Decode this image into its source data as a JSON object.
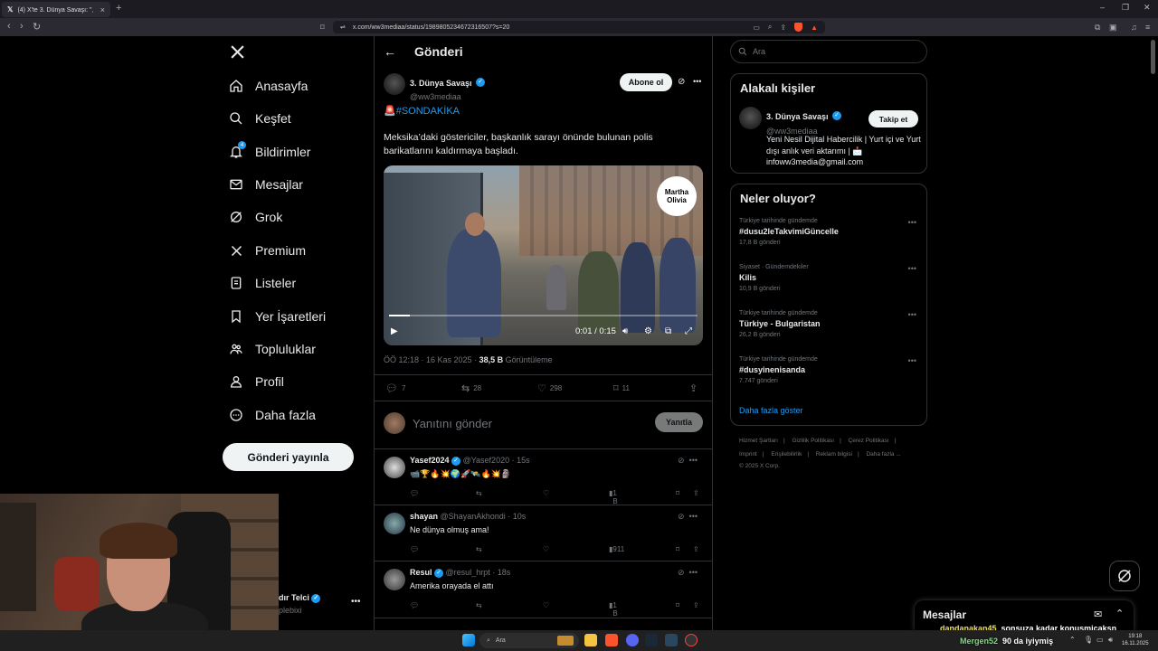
{
  "browser": {
    "tab_title": "(4) X'te 3. Dünya Savaşı: \"🚨#SO...",
    "url": "x.com/ww3mediaa/status/1989805234672316507?s=20"
  },
  "sidebar": {
    "items": [
      {
        "label": "Anasayfa"
      },
      {
        "label": "Keşfet"
      },
      {
        "label": "Bildirimler",
        "badge": "4"
      },
      {
        "label": "Mesajlar"
      },
      {
        "label": "Grok"
      },
      {
        "label": "Premium"
      },
      {
        "label": "Listeler"
      },
      {
        "label": "Yer İşaretleri"
      },
      {
        "label": "Topluluklar"
      },
      {
        "label": "Profil"
      },
      {
        "label": "Daha fazla"
      }
    ],
    "post_button": "Gönderi yayınla",
    "account_name": "dır Telci",
    "account_handle": "plebixi"
  },
  "header": {
    "title": "Gönderi"
  },
  "tweet": {
    "author_name": "3. Dünya Savaşı",
    "author_handle": "@ww3mediaa",
    "subscribe_label": "Abone ol",
    "hashtag": "🚨#SONDAKİKA",
    "text": "Meksika’daki göstericiler, başkanlık sarayı önünde bulunan polis barikatlarını kaldırmaya başladı.",
    "video_watermark": "Martha Olivia",
    "video_time": "0:01 / 0:15",
    "video_progress": 0.067,
    "timestamp": "ÖÖ 12:18 · 16 Kas 2025 ·",
    "views_count": "38,5 B",
    "views_label": "Görüntüleme",
    "replies": "7",
    "retweets": "28",
    "likes": "298",
    "bookmarks": "11",
    "reply_placeholder": "Yanıtını gönder",
    "reply_button": "Yanıtla"
  },
  "replies": [
    {
      "name": "Yasef2024",
      "handle": "@Yasef2020 · 15s",
      "text": "📹🏆🔥💥🌍🚀🛰️🔥💥🗿",
      "views": "1 B"
    },
    {
      "name": "shayan",
      "handle": "@ShayanAkhondi · 10s",
      "text": "Ne dünya olmuş ama!",
      "views": "911"
    },
    {
      "name": "Resul",
      "handle": "@resul_hrpt · 18s",
      "text": "Amerika orayada el attı",
      "views": "1 B"
    }
  ],
  "right": {
    "search_placeholder": "Ara",
    "related_title": "Alakalı kişiler",
    "related_name": "3. Dünya Savaşı",
    "related_handle": "@ww3mediaa",
    "follow_label": "Takip et",
    "related_bio": "Yeni Nesil Dijital Habercilik | Yurt içi ve Yurt dışı anlık veri aktarımı | 📩 infoww3media@gmail.com",
    "trends_title": "Neler oluyor?",
    "trends": [
      {
        "context": "Türkiye tarihinde gündemde",
        "name": "#dusu2leTakvimiGüncelle",
        "posts": "17,8 B gönderi"
      },
      {
        "context": "Siyaset · Gündemdekiler",
        "name": "Kilis",
        "posts": "10,9 B gönderi"
      },
      {
        "context": "Türkiye tarihinde gündemde",
        "name": "Türkiye - Bulgaristan",
        "posts": "26,2 B gönderi"
      },
      {
        "context": "Türkiye tarihinde gündemde",
        "name": "#dusyinenisanda",
        "posts": "7.747 gönderi"
      }
    ],
    "show_more": "Daha fazla göster",
    "footer": [
      "Hizmet Şartları",
      "Gizlilik Politikası",
      "Çerez Politikası",
      "Imprint",
      "Erişilebilirlik",
      "Reklam bilgisi",
      "Daha fazla ...",
      "© 2025 X Corp."
    ],
    "messages_title": "Mesajlar"
  },
  "chat": [
    {
      "user": "dandanakan45",
      "text": "sonsuza kadar konusmicaksn"
    },
    {
      "user": "Mergen52",
      "text": "90 da iyiymiş"
    }
  ],
  "taskbar": {
    "search_placeholder": "Ara",
    "time": "19:18",
    "date": "16.11.2025"
  }
}
